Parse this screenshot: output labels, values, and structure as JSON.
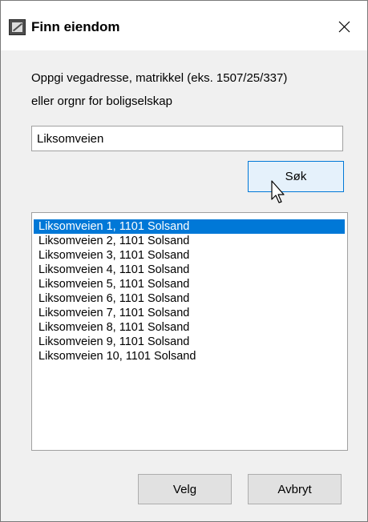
{
  "dialog": {
    "title": "Finn eiendom",
    "close_icon": "close-icon"
  },
  "instructions": {
    "line1": "Oppgi vegadresse, matrikkel  (eks. 1507/25/337)",
    "line2": "eller orgnr for boligselskap"
  },
  "search": {
    "value": "Liksomveien",
    "button_label": "Søk"
  },
  "results": {
    "selected_index": 0,
    "items": [
      "Liksomveien 1, 1101 Solsand",
      "Liksomveien 2, 1101 Solsand",
      "Liksomveien 3, 1101 Solsand",
      "Liksomveien 4, 1101 Solsand",
      "Liksomveien 5, 1101 Solsand",
      "Liksomveien 6, 1101 Solsand",
      "Liksomveien 7, 1101 Solsand",
      "Liksomveien 8, 1101 Solsand",
      "Liksomveien 9, 1101 Solsand",
      "Liksomveien 10, 1101 Solsand"
    ]
  },
  "footer": {
    "select_label": "Velg",
    "cancel_label": "Avbryt"
  },
  "colors": {
    "selection": "#0078d7",
    "dialog_bg": "#f0f0f0"
  }
}
